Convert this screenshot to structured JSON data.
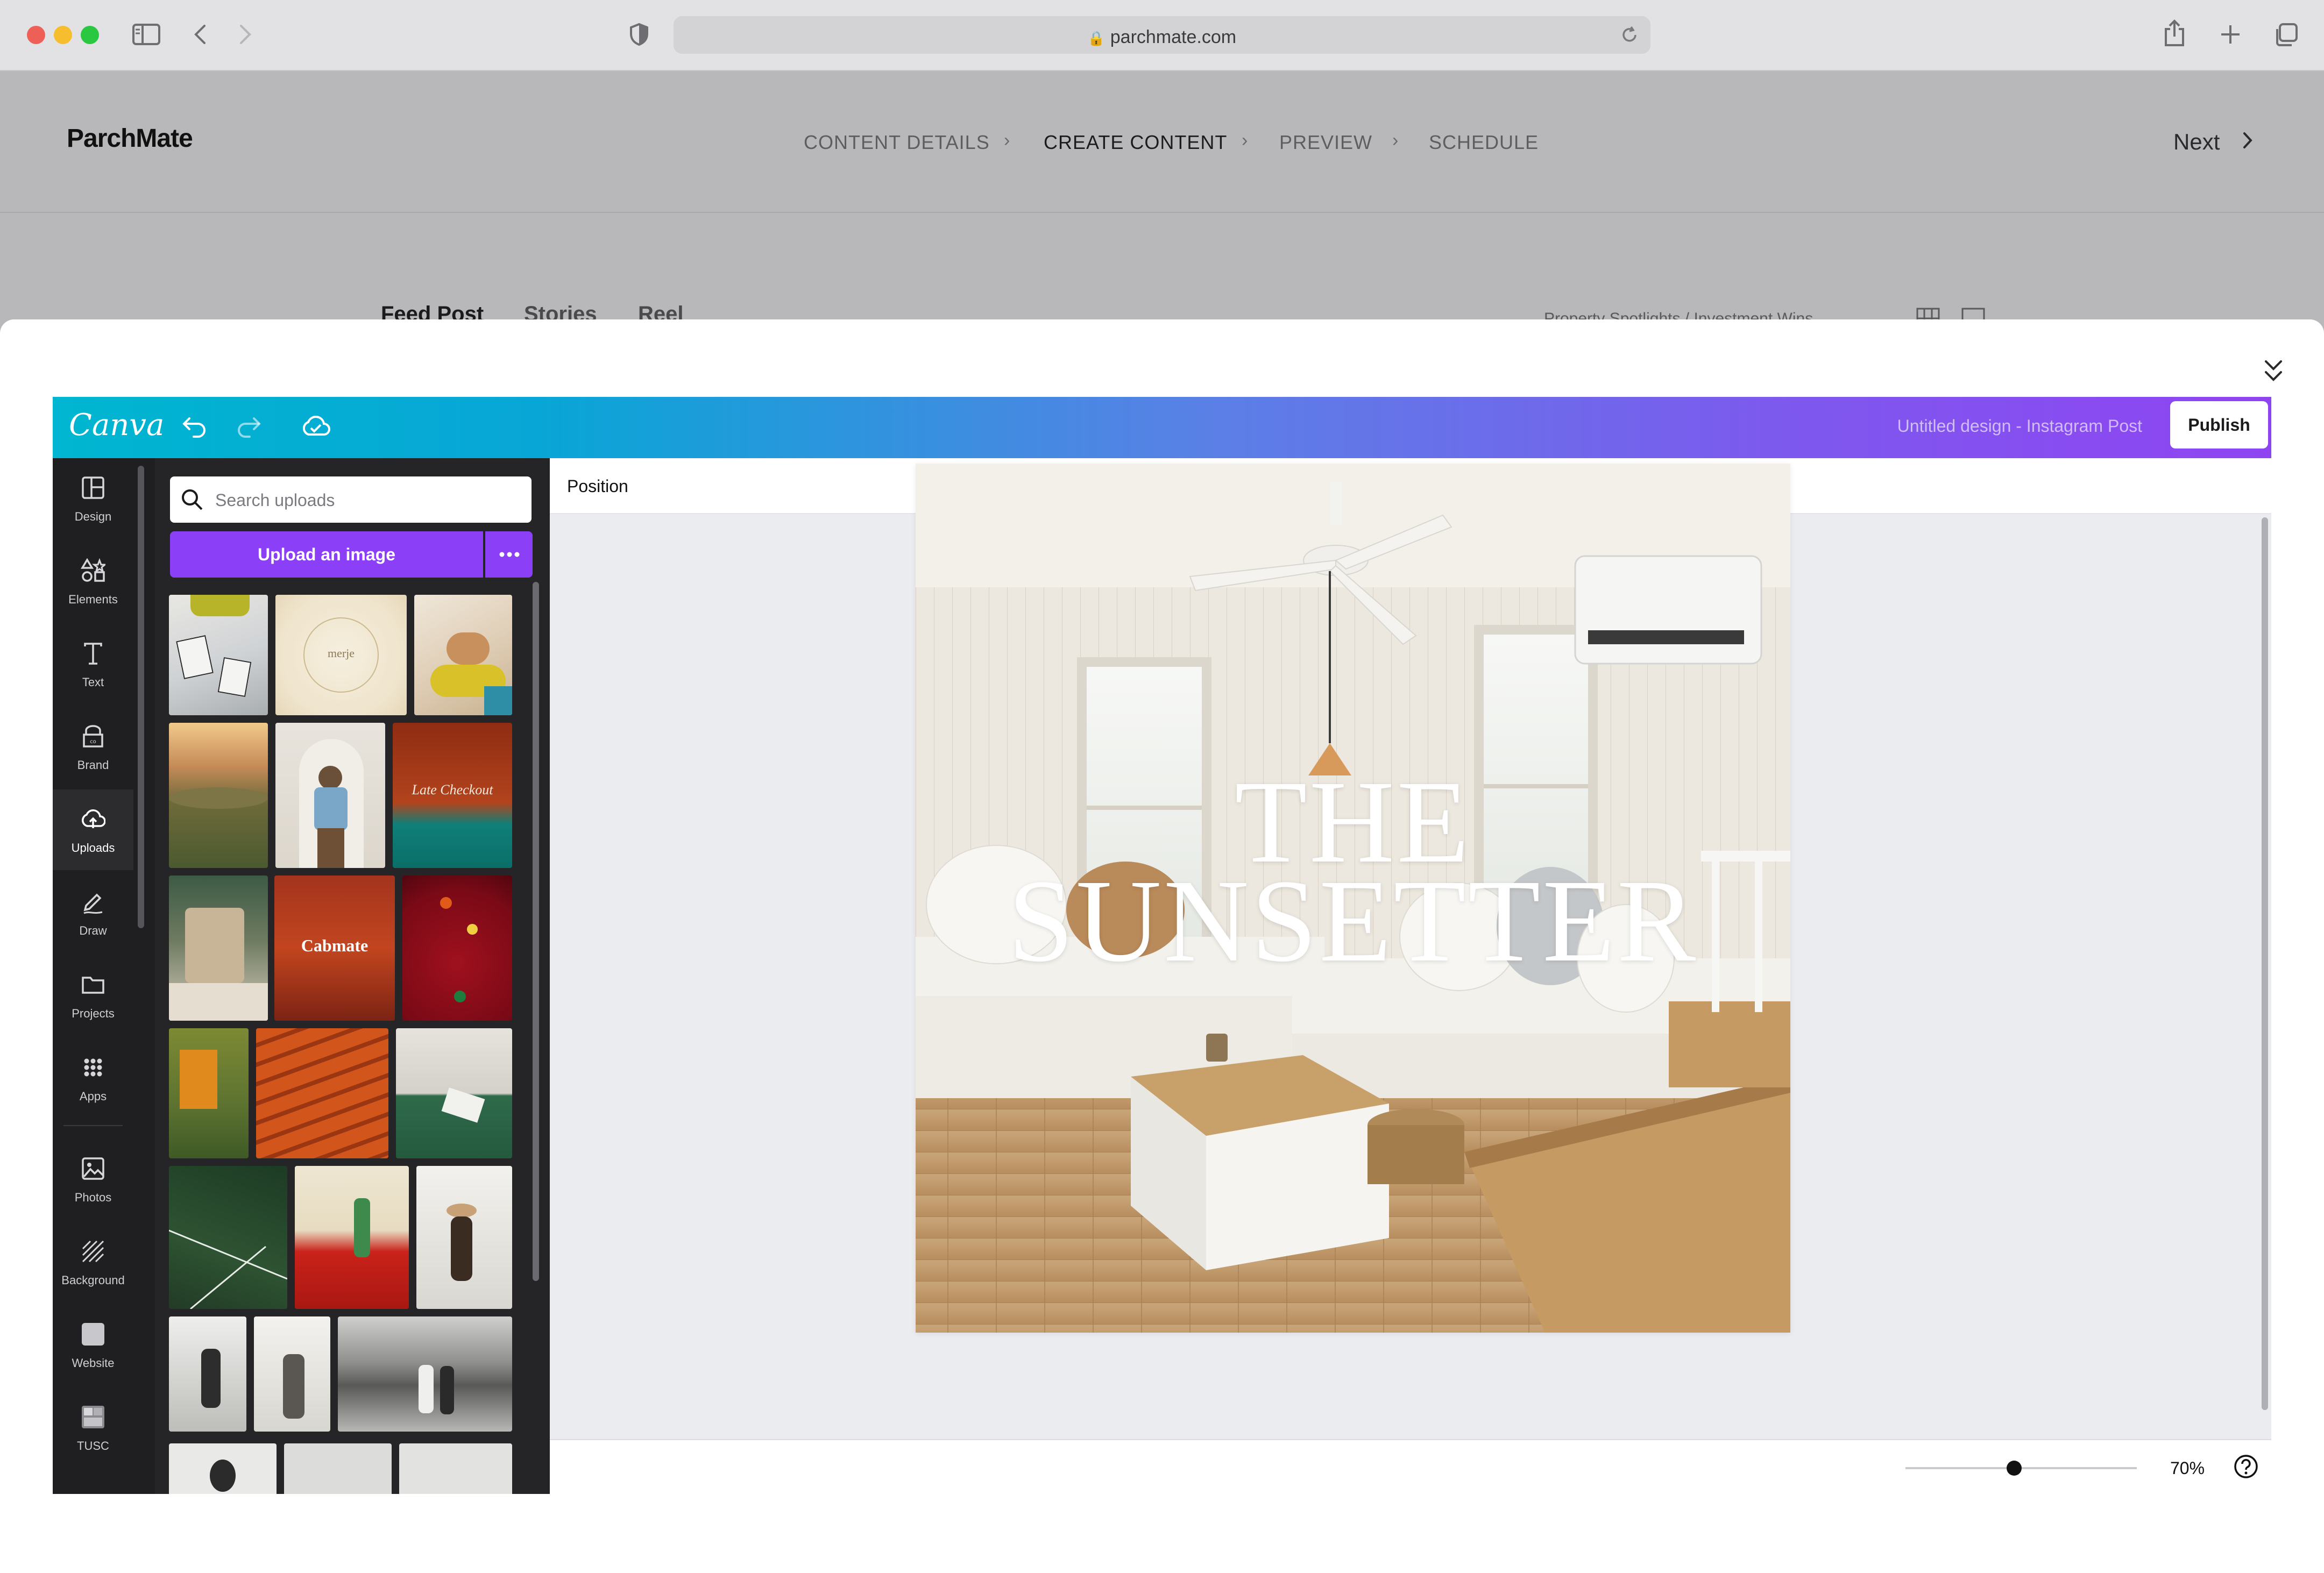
{
  "browser": {
    "url": "parchmate.com"
  },
  "app": {
    "brand": "ParchMate",
    "steps": [
      "CONTENT DETAILS",
      "CREATE CONTENT",
      "PREVIEW",
      "SCHEDULE"
    ],
    "active_step": "CREATE CONTENT",
    "next_label": "Next",
    "sub_tabs": [
      "Feed Post",
      "Stories",
      "Reel"
    ],
    "breadcrumb": "Property Spotlights   /   Investment Wins"
  },
  "editor": {
    "logo": "Canva",
    "design_title": "Untitled design - Instagram Post",
    "publish_label": "Publish",
    "rail_items": [
      {
        "label": "Design",
        "icon": "layout-icon"
      },
      {
        "label": "Elements",
        "icon": "shapes-icon"
      },
      {
        "label": "Text",
        "icon": "text-icon"
      },
      {
        "label": "Brand",
        "icon": "brand-icon"
      },
      {
        "label": "Uploads",
        "icon": "cloud-upload-icon"
      },
      {
        "label": "Draw",
        "icon": "pen-icon"
      },
      {
        "label": "Projects",
        "icon": "folder-icon"
      },
      {
        "label": "Apps",
        "icon": "apps-grid-icon"
      },
      {
        "label": "Photos",
        "icon": "image-icon"
      },
      {
        "label": "Background",
        "icon": "hatch-icon"
      },
      {
        "label": "Website",
        "icon": "website-icon"
      },
      {
        "label": "TUSC",
        "icon": "tusc-icon"
      }
    ],
    "active_rail": "Uploads",
    "search_placeholder": "Search uploads",
    "upload_label": "Upload an image",
    "context_label": "Position",
    "zoom_label": "70%",
    "zoom_fraction": 0.47,
    "design_text": {
      "line1": "THE",
      "line2": "SUNSETTER"
    },
    "thumb_texts": {
      "menu": "merje",
      "cabmate": "Cabmate",
      "chekout": "Late Checkout"
    }
  },
  "colors": {
    "canva_gradient_start": "#00b6d0",
    "canva_gradient_end": "#8f44f2",
    "upload_button": "#8b3ff6",
    "sidebar_bg": "#1f1f21"
  }
}
